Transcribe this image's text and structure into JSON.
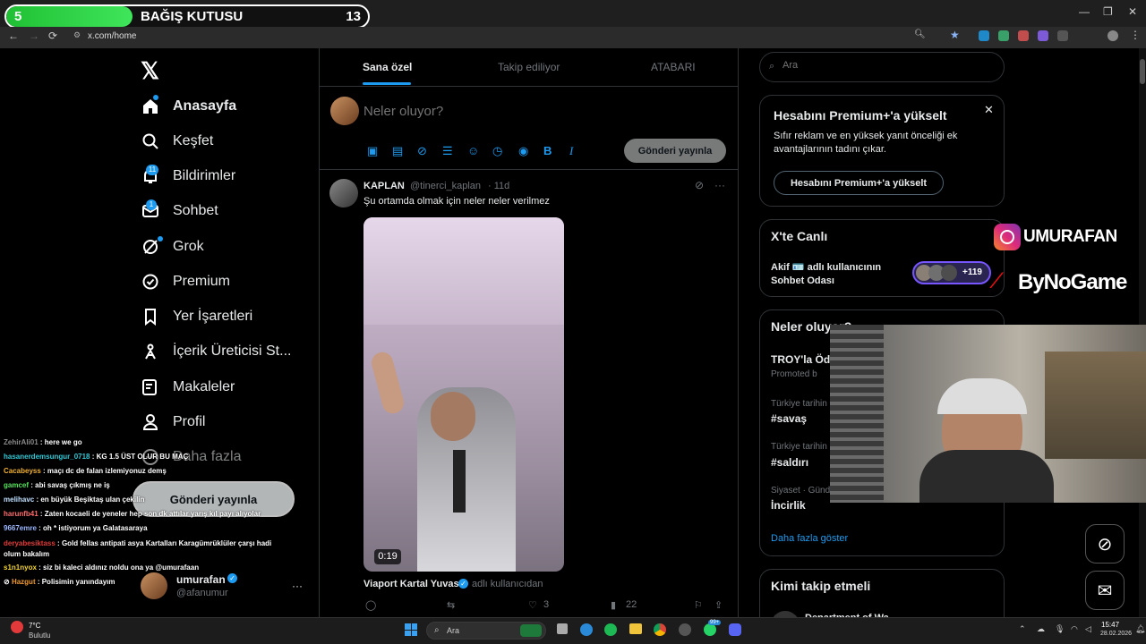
{
  "browser": {
    "url": "x.com/home"
  },
  "donation": {
    "left": "5",
    "title": "BAĞIŞ KUTUSU",
    "right": "13",
    "progress": 0.35
  },
  "sidebar": {
    "items": [
      {
        "label": "Anasayfa",
        "icon": "home-icon"
      },
      {
        "label": "Keşfet",
        "icon": "search-icon"
      },
      {
        "label": "Bildirimler",
        "icon": "bell-icon",
        "badge": "11"
      },
      {
        "label": "Sohbet",
        "icon": "mail-icon",
        "badge": "1"
      },
      {
        "label": "Grok",
        "icon": "grok-icon"
      },
      {
        "label": "Premium",
        "icon": "premium-icon"
      },
      {
        "label": "Yer İşaretleri",
        "icon": "bookmark-icon"
      },
      {
        "label": "İçerik Üreticisi St...",
        "icon": "creator-icon"
      },
      {
        "label": "Makaleler",
        "icon": "article-icon"
      },
      {
        "label": "Profil",
        "icon": "profile-icon"
      },
      {
        "label": "Daha fazla",
        "icon": "more-icon"
      }
    ],
    "post_button": "Gönderi yayınla",
    "account": {
      "name": "umurafan",
      "handle": "@afanumur",
      "more": "···"
    }
  },
  "tabs": [
    "Sana özel",
    "Takip ediliyor",
    "ATABARI"
  ],
  "composer": {
    "placeholder": "Neler oluyor?",
    "post_button": "Gönderi yayınla"
  },
  "tweet": {
    "name": "KAPLAN",
    "handle": "@tinerci_kaplan",
    "time": "· 11d",
    "text": "Şu ortamda olmak için neler neler verilmez",
    "video_duration": "0:19",
    "source": "Viaport Kartal Yuvası",
    "source_suffix": "adlı kullanıcıdan",
    "likes": "3",
    "views": "22"
  },
  "search": {
    "placeholder": "Ara"
  },
  "premium_card": {
    "title": "Hesabını Premium+'a yükselt",
    "body": "Sıfır reklam ve en yüksek yanıt önceliği ek avantajlarının tadını çıkar.",
    "button": "Hesabını Premium+'a yükselt"
  },
  "live": {
    "title": "X'te Canlı",
    "desc": "Akif 🪪 adlı kullanıcının Sohbet Odası",
    "count": "+119"
  },
  "trends": {
    "title": "Neler oluyor?",
    "items": [
      {
        "sub": "",
        "title": "TROY'la Öd",
        "note": "Promoted b"
      },
      {
        "sub": "Türkiye tarihin",
        "title": "#savaş"
      },
      {
        "sub": "Türkiye tarihin",
        "title": "#saldırı"
      },
      {
        "sub": "Siyaset · Günd",
        "title": "İncirlik"
      }
    ],
    "show_more": "Daha fazla göster"
  },
  "follow": {
    "title": "Kimi takip etmeli",
    "first": "Department of Wa"
  },
  "overlay": {
    "instagram": "UMURAFAN",
    "sponsor": "ByNoGame"
  },
  "chat": [
    {
      "user": "ZehirAli01",
      "msg": "here we go",
      "color": "#8b8b8b"
    },
    {
      "user": "hasanerdemsungur_0718",
      "msg": "KG 1.5 ÜST OLUR BU MAÇ",
      "color": "#31c8d6"
    },
    {
      "user": "Cacabeyss",
      "msg": "maçı dc de falan izlemiyonuz demş",
      "color": "#f2b134"
    },
    {
      "user": "gamcef",
      "msg": "abi savaş çıkmış ne iş",
      "color": "#54e35b"
    },
    {
      "user": "melihavc",
      "msg": "en büyük Beşiktaş ulan çekilin",
      "color": "#bfe0ff"
    },
    {
      "user": "harunfb41",
      "msg": "Zaten kocaeli de yeneler hep son dk attılar yarış kıl payı alıyolar",
      "color": "#ff6b6b"
    },
    {
      "user": "9667emre",
      "msg": "oh * istiyorum ya Galatasaraya",
      "color": "#9bb7ff"
    },
    {
      "user": "deryabesiktass",
      "msg": "Gold fellas antipati asya Kartalları Karagümrüklüler çarşı hadi olum bakalım",
      "color": "#e23a3a"
    },
    {
      "user": "s1n1nyox",
      "msg": "siz bi kaleci aldınız noldu ona ya @umurafaan",
      "color": "#f2d430"
    },
    {
      "user": "Hazgut",
      "msg": "Polisimin yanındayım",
      "color": "#f09a30"
    }
  ],
  "taskbar": {
    "weather_temp": "7°C",
    "weather_text": "Bulutlu",
    "search": "Ara",
    "time": "15:47",
    "date": "28.02.2026",
    "badge1": "99+"
  }
}
